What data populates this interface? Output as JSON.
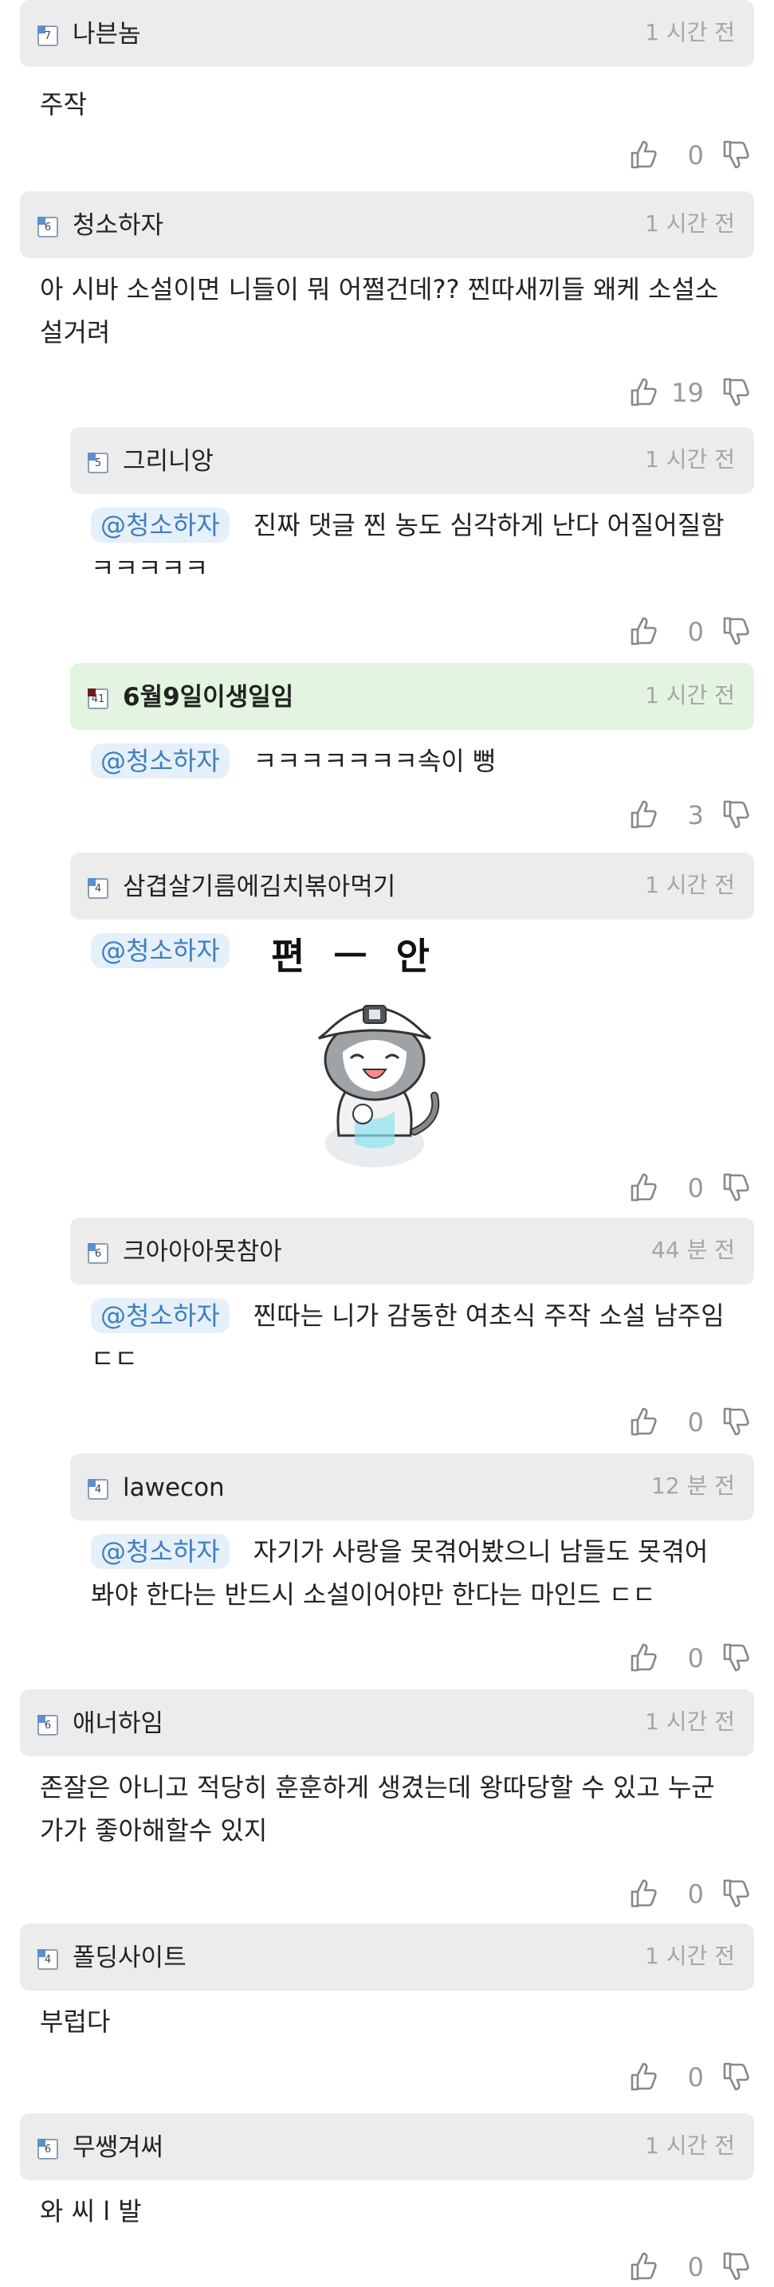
{
  "comments": [
    {
      "level": "7",
      "nick": "나븐놈",
      "time": "1 시간 전",
      "mention": "",
      "text": "주작",
      "likes": "0"
    },
    {
      "level": "6",
      "nick": "청소하자",
      "time": "1 시간 전",
      "mention": "",
      "text_lines": [
        "아 시바 소설이면 니들이 뭐 어쩔건데?? 찐따새끼들 왜케 소설소",
        "설거려"
      ],
      "likes": "19"
    },
    {
      "level": "5",
      "nick": "그리니앙",
      "time": "1 시간 전",
      "mention": "@청소하자",
      "text_lines": [
        "진짜 댓글 찐 농도 심각하게 난다 어질어질함",
        "ㅋㅋㅋㅋㅋ"
      ],
      "likes": "0"
    },
    {
      "level": "41",
      "nick": "6월9일이생일임",
      "time": "1 시간 전",
      "mention": "@청소하자",
      "text": "ㅋㅋㅋㅋㅋㅋㅋ속이 뻥",
      "likes": "3"
    },
    {
      "level": "4",
      "nick": "삼겹살기름에김치볶아먹기",
      "time": "1 시간 전",
      "mention": "@청소하자",
      "sticker_text": "편 ㅡ 안",
      "likes": "0"
    },
    {
      "level": "6",
      "nick": "크아아아못참아",
      "time": "44 분 전",
      "mention": "@청소하자",
      "text_lines": [
        "찐따는 니가 감동한 여초식 주작 소설 남주임",
        "ㄷㄷ"
      ],
      "likes": "0"
    },
    {
      "level": "4",
      "nick": "lawecon",
      "time": "12 분 전",
      "mention": "@청소하자",
      "text_lines": [
        "자기가 사랑을 못겪어봤으니 남들도 못겪어",
        "봐야 한다는 반드시 소설이어야만 한다는 마인드 ㄷㄷ"
      ],
      "likes": "0"
    },
    {
      "level": "6",
      "nick": "애너하임",
      "time": "1 시간 전",
      "mention": "",
      "text_lines": [
        "존잘은 아니고 적당히 훈훈하게 생겼는데 왕따당할 수 있고 누군",
        "가가 좋아해할수 있지"
      ],
      "likes": "0"
    },
    {
      "level": "4",
      "nick": "폴딩사이트",
      "time": "1 시간 전",
      "mention": "",
      "text": "부럽다",
      "likes": "0"
    },
    {
      "level": "6",
      "nick": "무쌩겨써",
      "time": "1 시간 전",
      "mention": "",
      "text": "와 씨 l 발",
      "likes": "0"
    }
  ],
  "colors": {
    "header_bg": "#ececec",
    "highlight_bg": "#e3f5e0",
    "mention_bg": "#e6f0fa",
    "mention_fg": "#3f7fbf",
    "time": "#a6a6a6"
  },
  "icons": [
    "thumbs-up-icon",
    "thumbs-down-icon",
    "level-badge-icon",
    "cat-sticker"
  ]
}
